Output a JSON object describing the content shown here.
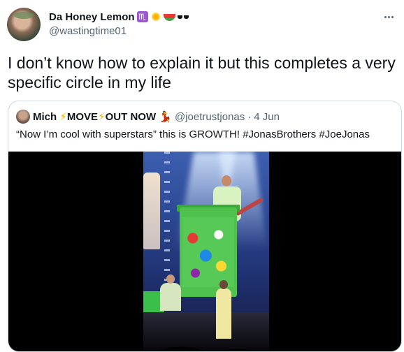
{
  "tweet": {
    "display_name": "Da Honey Lemon",
    "name_emojis": [
      "scorpio-icon",
      "sun-icon",
      "watermelon-icon",
      "sunglasses-icon"
    ],
    "scorpio_glyph": "♏",
    "handle": "@wastingtime01",
    "text": "I don’t know how to explain it but this completes a very specific circle in my life"
  },
  "quote": {
    "name_part1": "Mich ",
    "bolt1": "⚡",
    "name_part2": "MOVE",
    "bolt2": "⚡",
    "name_part3": "OUT NOW",
    "dancer": "💃",
    "handle": "@joetrustjonas",
    "separator": "·",
    "date": "4 Jun",
    "text": "“Now I’m cool with superstars” this is GROWTH! #JonasBrothers #JoeJonas"
  },
  "colors": {
    "text_primary": "#0f1419",
    "text_secondary": "#536471",
    "border": "#cfd9de"
  }
}
